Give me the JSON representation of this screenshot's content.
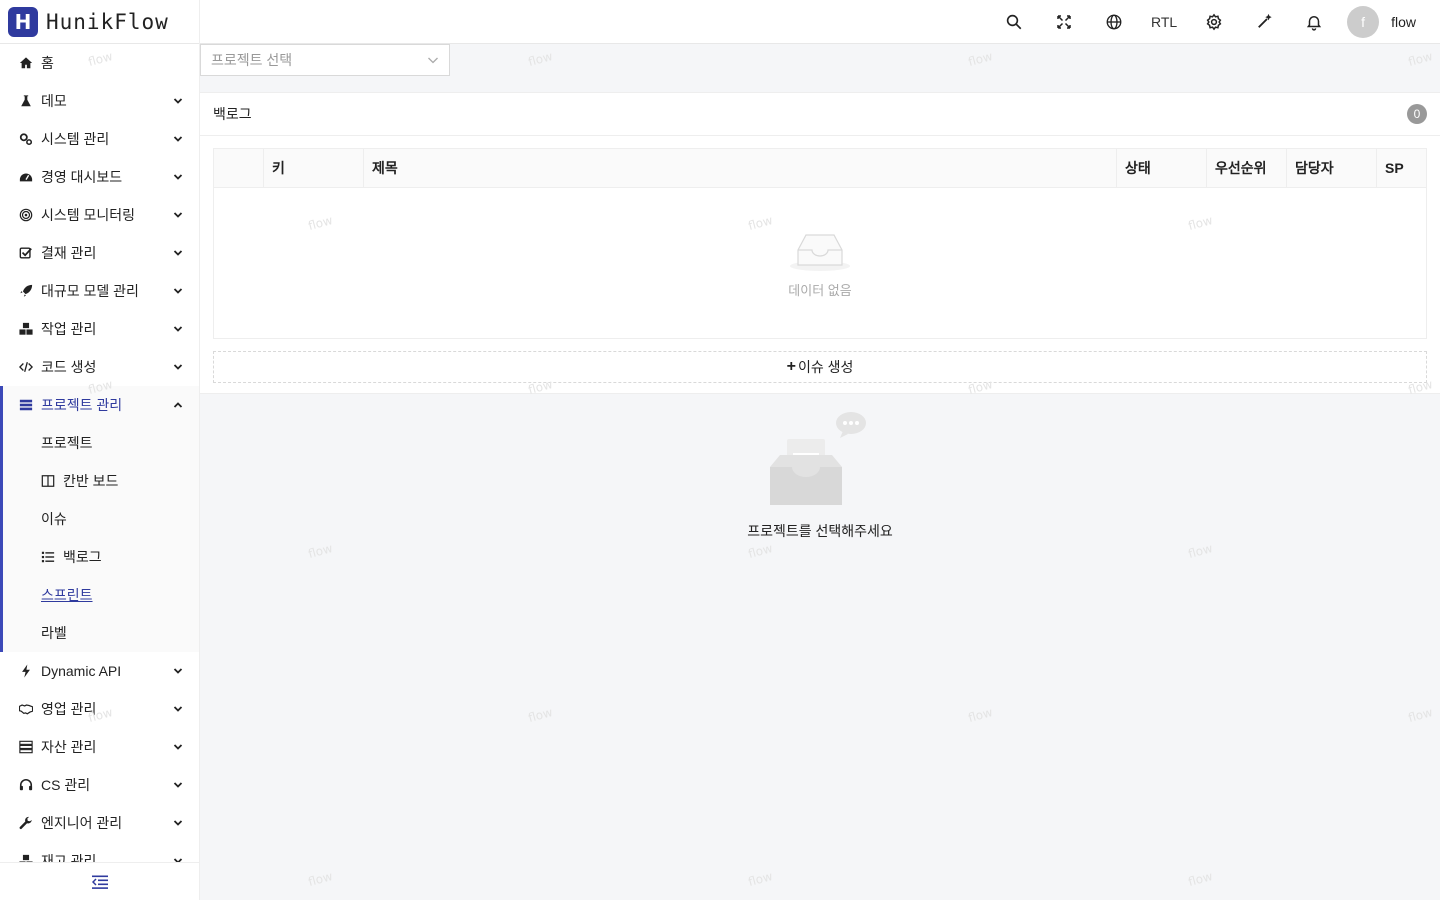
{
  "header": {
    "logo_letter": "H",
    "app_name": "HunikFlow",
    "rtl_label": "RTL",
    "user": {
      "initial": "f",
      "name": "flow"
    }
  },
  "sidebar": {
    "items": [
      {
        "label": "홈",
        "icon": "home-icon"
      },
      {
        "label": "데모",
        "icon": "flask-icon"
      },
      {
        "label": "시스템 관리",
        "icon": "gears-icon"
      },
      {
        "label": "경영 대시보드",
        "icon": "dashboard-icon"
      },
      {
        "label": "시스템 모니터링",
        "icon": "target-icon"
      },
      {
        "label": "결재 관리",
        "icon": "check-square-icon"
      },
      {
        "label": "대규모 모델 관리",
        "icon": "rocket-icon"
      },
      {
        "label": "작업 관리",
        "icon": "cubes-icon"
      },
      {
        "label": "코드 생성",
        "icon": "code-icon"
      },
      {
        "label": "프로젝트 관리",
        "icon": "list-icon"
      }
    ],
    "submenu": [
      {
        "label": "프로젝트"
      },
      {
        "label": "칸반 보드"
      },
      {
        "label": "이슈"
      },
      {
        "label": "백로그"
      },
      {
        "label": "스프린트"
      },
      {
        "label": "라벨"
      }
    ],
    "items_after": [
      {
        "label": "Dynamic API",
        "icon": "bolt-icon"
      },
      {
        "label": "영업 관리",
        "icon": "handshake-icon"
      },
      {
        "label": "자산 관리",
        "icon": "server-icon"
      },
      {
        "label": "CS 관리",
        "icon": "headset-icon"
      },
      {
        "label": "엔지니어 관리",
        "icon": "wrench-icon"
      },
      {
        "label": "재고 관리",
        "icon": "boxes-icon"
      }
    ]
  },
  "main": {
    "project_select_placeholder": "프로젝트 선택",
    "backlog": {
      "title": "백로그",
      "count": "0",
      "columns": [
        "",
        "키",
        "제목",
        "상태",
        "우선순위",
        "담당자",
        "SP"
      ],
      "empty_text": "데이터 없음",
      "create_label": "이슈 생성"
    },
    "placeholder_text": "프로젝트를 선택해주세요"
  },
  "watermark": "flow"
}
